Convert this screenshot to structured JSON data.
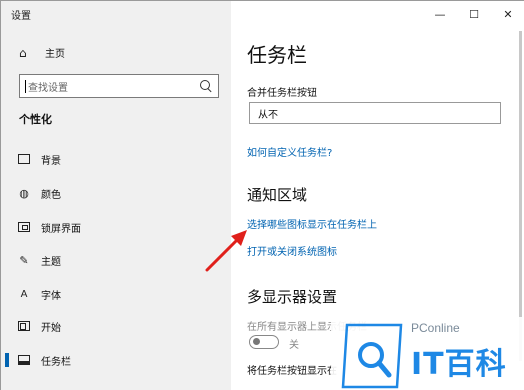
{
  "window": {
    "title": "设置",
    "controls": {
      "minimize": "—",
      "maximize": "☐",
      "close": "✕"
    }
  },
  "sidebar": {
    "home_label": "主页",
    "search_placeholder": "查找设置",
    "section_title": "个性化",
    "items": [
      {
        "label": "背景",
        "icon": "background-icon"
      },
      {
        "label": "颜色",
        "icon": "palette-icon"
      },
      {
        "label": "锁屏界面",
        "icon": "lock-screen-icon"
      },
      {
        "label": "主题",
        "icon": "theme-icon"
      },
      {
        "label": "字体",
        "icon": "font-icon"
      },
      {
        "label": "开始",
        "icon": "start-icon"
      },
      {
        "label": "任务栏",
        "icon": "taskbar-icon",
        "active": true
      }
    ]
  },
  "main": {
    "title": "任务栏",
    "combine_label": "合并任务栏按钮",
    "combine_value": "从不",
    "customize_link": "如何自定义任务栏?",
    "notification_heading": "通知区域",
    "select_icons_link": "选择哪些图标显示在任务栏上",
    "system_icons_link": "打开或关闭系统图标",
    "multi_display_heading": "多显示器设置",
    "show_all_displays_label": "在所有显示器上显示任务栏",
    "toggle_state": "关",
    "show_buttons_label": "将任务栏按钮显示在"
  },
  "watermark": {
    "brand": "PConline",
    "logo_text": "IT百科"
  },
  "colors": {
    "accent": "#0063b1",
    "arrow": "#e0201b",
    "watermark": "#1e88e5"
  }
}
